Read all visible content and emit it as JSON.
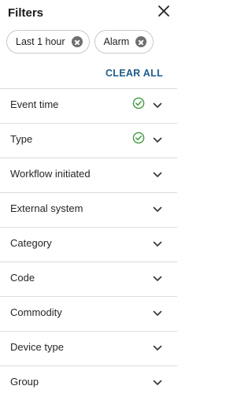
{
  "header": {
    "title": "Filters",
    "close_icon": "close-icon"
  },
  "chips": [
    {
      "label": "Last 1 hour",
      "remove_icon": "remove-circle-icon"
    },
    {
      "label": "Alarm",
      "remove_icon": "remove-circle-icon"
    }
  ],
  "clear_all_label": "CLEAR ALL",
  "colors": {
    "accent": "#1d5d8c",
    "check": "#3f9b3f",
    "chip_border": "#c9c9c9",
    "divider": "#dcdcdc"
  },
  "filters": [
    {
      "label": "Event time",
      "applied": true
    },
    {
      "label": "Type",
      "applied": true
    },
    {
      "label": "Workflow initiated",
      "applied": false
    },
    {
      "label": "External system",
      "applied": false
    },
    {
      "label": "Category",
      "applied": false
    },
    {
      "label": "Code",
      "applied": false
    },
    {
      "label": "Commodity",
      "applied": false
    },
    {
      "label": "Device type",
      "applied": false
    },
    {
      "label": "Group",
      "applied": false
    }
  ]
}
